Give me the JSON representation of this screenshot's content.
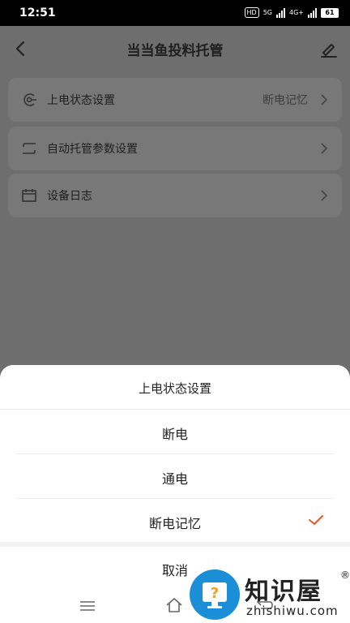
{
  "status_bar": {
    "time": "12:51",
    "hd_badge": "HD",
    "network_5g": "5G",
    "network_4g": "4G+",
    "battery": "61"
  },
  "header": {
    "title": "当当鱼投料托管"
  },
  "menu": {
    "items": [
      {
        "label": "上电状态设置",
        "value": "断电记忆",
        "icon": "power-plug-icon"
      },
      {
        "label": "自动托管参数设置",
        "value": "",
        "icon": "loop-icon"
      },
      {
        "label": "设备日志",
        "value": "",
        "icon": "calendar-icon"
      }
    ]
  },
  "sheet": {
    "title": "上电状态设置",
    "options": [
      {
        "label": "断电",
        "selected": false
      },
      {
        "label": "通电",
        "selected": false
      },
      {
        "label": "断电记忆",
        "selected": true
      }
    ],
    "cancel": "取消",
    "accent_color": "#e8572a"
  },
  "watermark": {
    "brand": "知识屋",
    "registered": "®",
    "url": "zhishiwu.com"
  }
}
